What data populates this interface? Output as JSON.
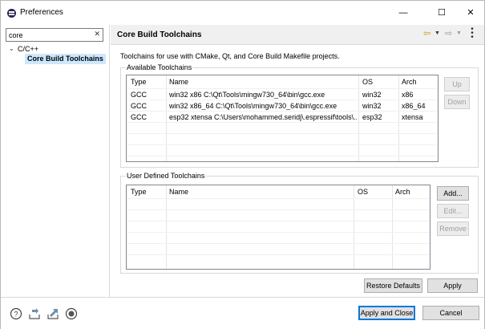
{
  "window": {
    "title": "Preferences",
    "minimize": "—",
    "maximize": "☐",
    "close": "✕"
  },
  "sidebar": {
    "filter_value": "core",
    "filter_clear": "✕",
    "tree": {
      "expander": "⌄",
      "parent": "C/C++",
      "selected": "Core Build Toolchains"
    }
  },
  "main": {
    "title": "Core Build Toolchains",
    "description": "Toolchains for use with CMake, Qt, and Core Build Makefile projects.",
    "available": {
      "label": "Available Toolchains",
      "columns": [
        "Type",
        "Name",
        "OS",
        "Arch"
      ],
      "rows": [
        {
          "type": "GCC",
          "name": "win32 x86 C:\\Qt\\Tools\\mingw730_64\\bin\\gcc.exe",
          "os": "win32",
          "arch": "x86"
        },
        {
          "type": "GCC",
          "name": "win32 x86_64 C:\\Qt\\Tools\\mingw730_64\\bin\\gcc.exe",
          "os": "win32",
          "arch": "x86_64"
        },
        {
          "type": "GCC",
          "name": "esp32 xtensa C:\\Users\\mohammed.seridj\\.espressif\\tools\\...",
          "os": "esp32",
          "arch": "xtensa"
        }
      ],
      "up_label": "Up",
      "down_label": "Down"
    },
    "user_defined": {
      "label": "User Defined Toolchains",
      "columns": [
        "Type",
        "Name",
        "OS",
        "Arch"
      ],
      "add_label": "Add...",
      "edit_label": "Edit...",
      "remove_label": "Remove"
    },
    "restore_defaults_label": "Restore Defaults",
    "apply_label": "Apply"
  },
  "footer": {
    "apply_close_label": "Apply and Close",
    "cancel_label": "Cancel"
  },
  "colors": {
    "selection": "#cce8ff",
    "default_button_border": "#0078d7",
    "header_strip": "#f0f0f0"
  }
}
